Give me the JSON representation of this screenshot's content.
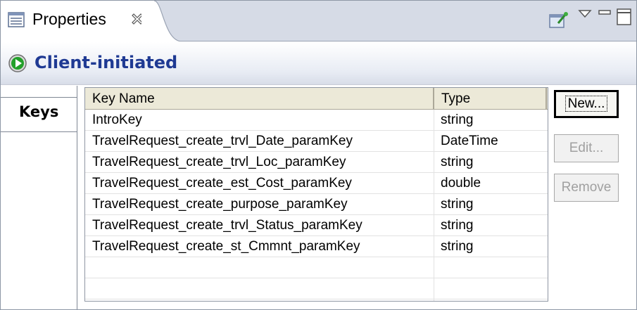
{
  "view": {
    "tab_title": "Properties",
    "form_title": "Client-initiated",
    "side_tab_label": "Keys"
  },
  "table": {
    "columns": [
      "Key Name",
      "Type"
    ],
    "rows": [
      {
        "key_name": "IntroKey",
        "type": "string"
      },
      {
        "key_name": "TravelRequest_create_trvl_Date_paramKey",
        "type": "DateTime"
      },
      {
        "key_name": "TravelRequest_create_trvl_Loc_paramKey",
        "type": "string"
      },
      {
        "key_name": "TravelRequest_create_est_Cost_paramKey",
        "type": "double"
      },
      {
        "key_name": "TravelRequest_create_purpose_paramKey",
        "type": "string"
      },
      {
        "key_name": "TravelRequest_create_trvl_Status_paramKey",
        "type": "string"
      },
      {
        "key_name": "TravelRequest_create_st_Cmmnt_paramKey",
        "type": "string"
      },
      {
        "key_name": "",
        "type": ""
      },
      {
        "key_name": "",
        "type": ""
      }
    ]
  },
  "buttons": {
    "new_label": "New...",
    "edit_label": "Edit...",
    "remove_label": "Remove"
  },
  "icons": {
    "tab_icon": "properties-list-icon",
    "close_icon": "close-icon",
    "pin_icon": "pin-editor-icon",
    "menu_icon": "view-menu-icon",
    "minimize_icon": "minimize-icon",
    "maximize_icon": "maximize-icon",
    "form_icon": "run-green-icon"
  },
  "colors": {
    "form_title": "#1f3a93",
    "tabbar_bg": "#d6dbe6",
    "run_icon": "#22a02a"
  }
}
